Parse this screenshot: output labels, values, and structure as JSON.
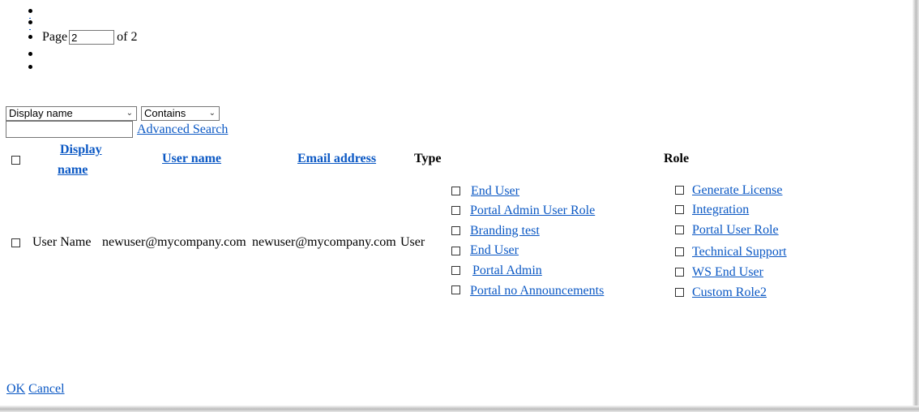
{
  "pager": {
    "page_label": "Page",
    "page_value": "2",
    "of_label": "of 2"
  },
  "search": {
    "field_select": "Display name",
    "operator_select": "Contains",
    "query_value": "",
    "advanced_search": "Advanced Search"
  },
  "table": {
    "headers": {
      "display_name_line1": "Display",
      "display_name_line2": "name",
      "user_name": "User name",
      "email_address": "Email address",
      "type": "Type",
      "role": "Role"
    },
    "row": {
      "display_name": "User Name",
      "user_name": "newuser@mycompany.com",
      "email": "newuser@mycompany.com",
      "type": "User"
    },
    "type_roles": [
      "End User",
      "Portal Admin User Role",
      "Branding test",
      "End User",
      "Portal Admin",
      "Portal no Announcements"
    ],
    "roles": [
      "Generate License",
      "Integration",
      "Portal User Role",
      "Technical Support",
      "WS End User",
      "Custom Role2"
    ]
  },
  "footer": {
    "ok": "OK",
    "cancel": "Cancel"
  }
}
